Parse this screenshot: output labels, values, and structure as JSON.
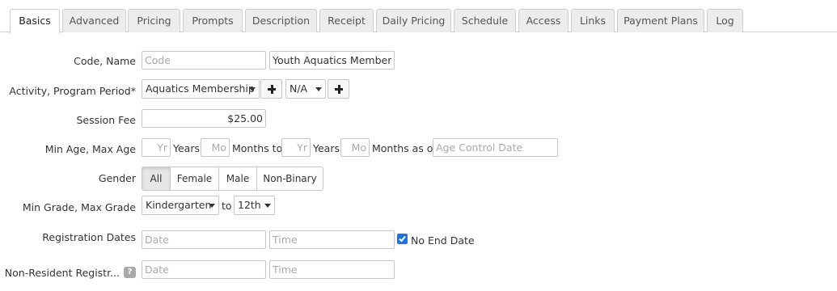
{
  "tabs": [
    "Basics",
    "Advanced",
    "Pricing",
    "Prompts",
    "Description",
    "Receipt",
    "Daily Pricing",
    "Schedule",
    "Access",
    "Links",
    "Payment Plans",
    "Log"
  ],
  "active_tab": "Basics",
  "form": {
    "code_name_label": "Code, Name",
    "code_placeholder": "Code",
    "name_value": "Youth Aquatics Membersh",
    "activity_label": "Activity, Program Period*",
    "activity_value": "Aquatics Membership",
    "program_period_value": "N/A",
    "session_fee_label": "Session Fee",
    "session_fee_value": "$25.00",
    "age_label": "Min Age, Max Age",
    "yr_placeholder": "Yr",
    "mo_placeholder": "Mo",
    "years_text": "Years",
    "months_to_text": "Months to",
    "months_as_of_text": "Months as of",
    "age_control_placeholder": "Age Control Date",
    "gender_label": "Gender",
    "gender_options": [
      "All",
      "Female",
      "Male",
      "Non-Binary"
    ],
    "gender_selected": "All",
    "grade_label": "Min Grade, Max Grade",
    "min_grade_value": "Kindergarten",
    "to_text": "to",
    "max_grade_value": "12th",
    "reg_dates_label": "Registration Dates",
    "date_placeholder": "Date",
    "time_placeholder": "Time",
    "no_end_date_label": "No End Date",
    "no_end_date_checked": true,
    "nonres_label": "Non-Resident Registr...",
    "help_icon_text": "?"
  },
  "colors": {
    "checkbox": "#1a73e8",
    "active_segment": "#e6e6e6",
    "tab_inactive": "#ececec"
  }
}
